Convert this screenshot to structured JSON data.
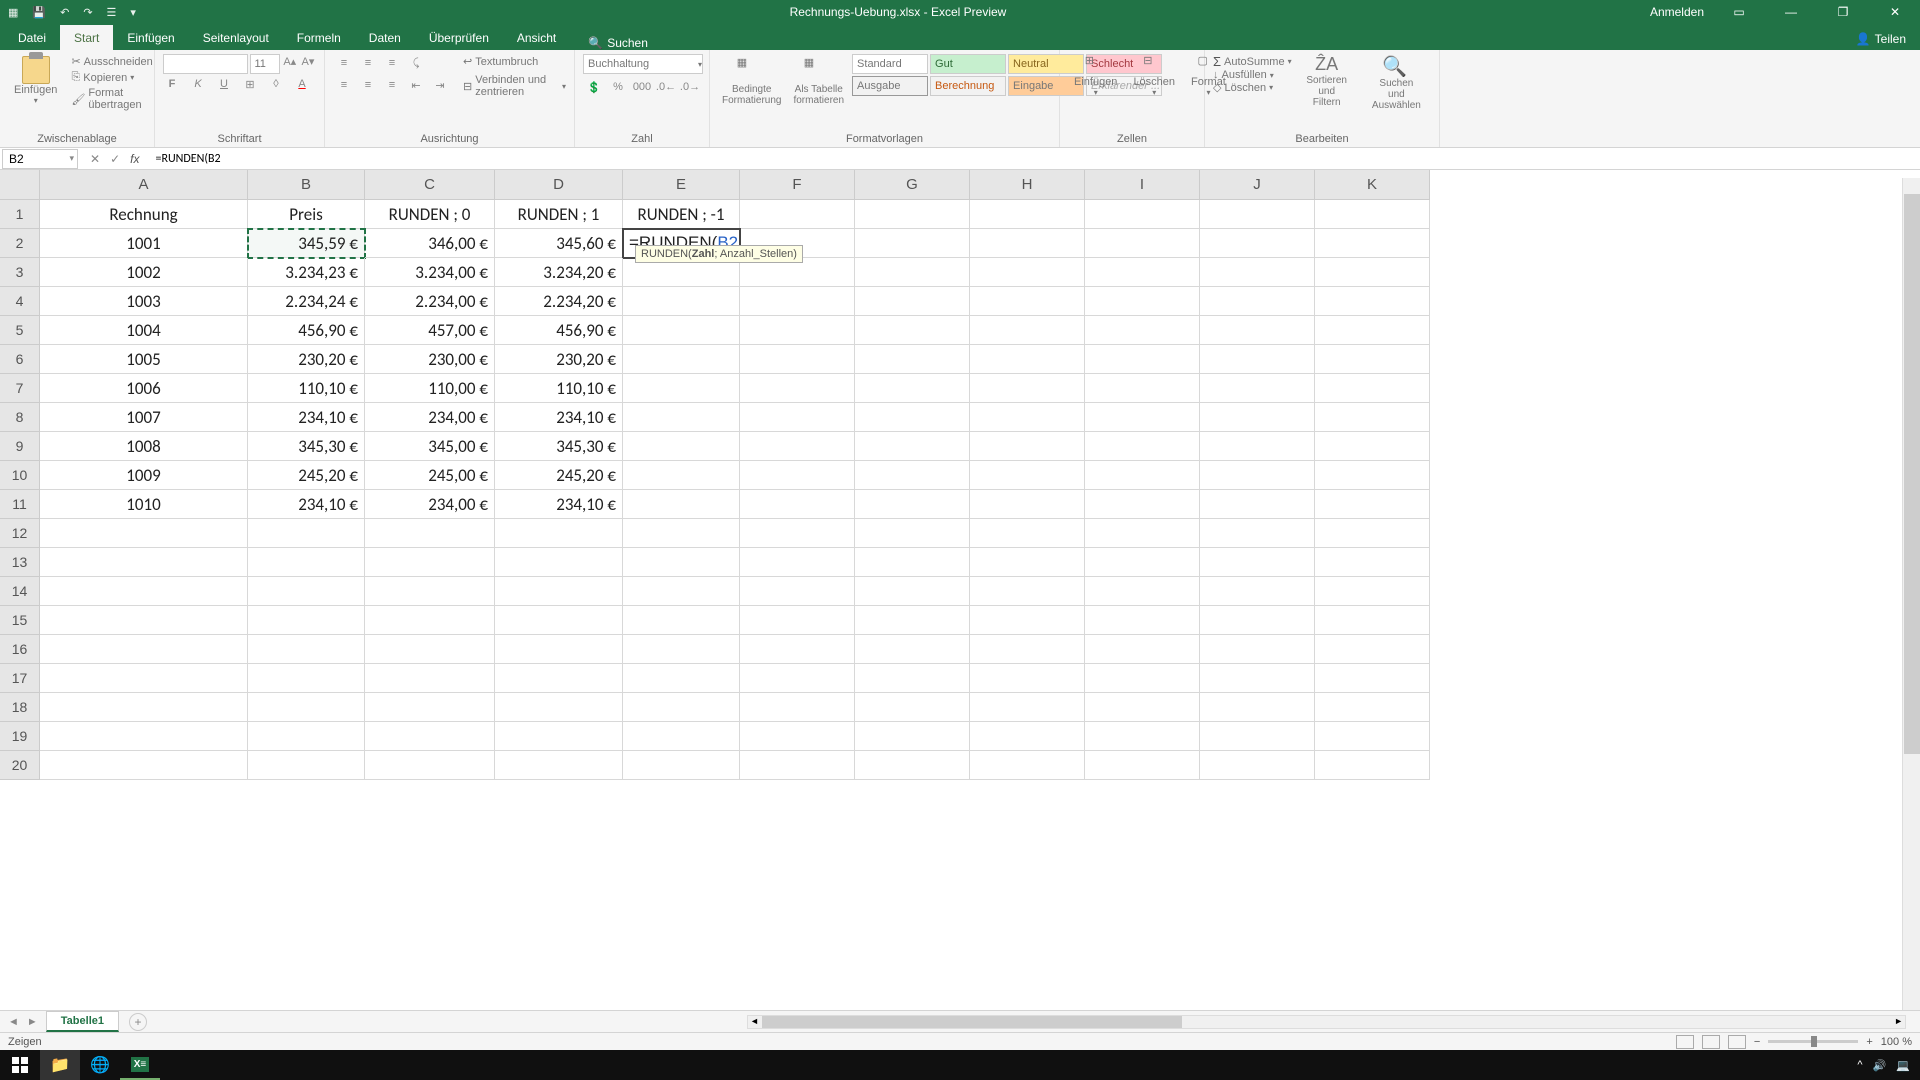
{
  "title": "Rechnungs-Uebung.xlsx - Excel Preview",
  "user_label": "Anmelden",
  "qat": {
    "save": "💾",
    "undo": "↶",
    "redo": "↷",
    "touch": "☰"
  },
  "ribbon_tabs": [
    "Datei",
    "Start",
    "Einfügen",
    "Seitenlayout",
    "Formeln",
    "Daten",
    "Überprüfen",
    "Ansicht"
  ],
  "ribbon_search_icon": "🔍",
  "ribbon_search": "Suchen",
  "ribbon_share": "Teilen",
  "ribbon": {
    "clipboard": {
      "paste": "Einfügen",
      "cut": "Ausschneiden",
      "copy": "Kopieren",
      "format": "Format übertragen",
      "label": "Zwischenablage"
    },
    "font": {
      "size": "11",
      "bold": "F",
      "italic": "K",
      "underline": "U",
      "label": "Schriftart"
    },
    "align": {
      "wrap": "Textumbruch",
      "merge": "Verbinden und zentrieren",
      "label": "Ausrichtung"
    },
    "number": {
      "format": "Buchhaltung",
      "label": "Zahl"
    },
    "styles": {
      "cond": "Bedingte Formatierung",
      "table": "Als Tabelle formatieren",
      "standard": "Standard",
      "gut": "Gut",
      "neutral": "Neutral",
      "schlecht": "Schlecht",
      "ausgabe": "Ausgabe",
      "berechnung": "Berechnung",
      "eingabe": "Eingabe",
      "erkl": "Erklärender ...",
      "label": "Formatvorlagen"
    },
    "cells": {
      "insert": "Einfügen",
      "delete": "Löschen",
      "format": "Format",
      "label": "Zellen"
    },
    "edit": {
      "sum": "AutoSumme",
      "fill": "Ausfüllen",
      "clear": "Löschen",
      "sort": "Sortieren und Filtern",
      "find": "Suchen und Auswählen",
      "label": "Bearbeiten"
    }
  },
  "name_box": "B2",
  "formula": "=RUNDEN(B2",
  "tooltip": {
    "fn": "RUNDEN(",
    "arg1": "Zahl",
    "sep": "; ",
    "arg2": "Anzahl_Stellen)"
  },
  "columns": [
    "A",
    "B",
    "C",
    "D",
    "E",
    "F",
    "G",
    "H",
    "I",
    "J",
    "K"
  ],
  "col_widths": {
    "A": 208,
    "B": 117,
    "C": 130,
    "D": 128,
    "E": 117,
    "F": 115,
    "G": 115,
    "H": 115,
    "I": 115,
    "J": 115,
    "K": 115
  },
  "row_numbers": [
    1,
    2,
    3,
    4,
    5,
    6,
    7,
    8,
    9,
    10,
    11,
    12,
    13,
    14,
    15,
    16,
    17,
    18,
    19,
    20
  ],
  "headers": {
    "A": "Rechnung",
    "B": "Preis",
    "C": "RUNDEN ; 0",
    "D": "RUNDEN ; 1",
    "E": "RUNDEN ; -1"
  },
  "data_rows": [
    {
      "A": "1001",
      "B": "345,59 €",
      "C": "346,00 €",
      "D": "345,60 €"
    },
    {
      "A": "1002",
      "B": "3.234,23 €",
      "C": "3.234,00 €",
      "D": "3.234,20 €"
    },
    {
      "A": "1003",
      "B": "2.234,24 €",
      "C": "2.234,00 €",
      "D": "2.234,20 €"
    },
    {
      "A": "1004",
      "B": "456,90 €",
      "C": "457,00 €",
      "D": "456,90 €"
    },
    {
      "A": "1005",
      "B": "230,20 €",
      "C": "230,00 €",
      "D": "230,20 €"
    },
    {
      "A": "1006",
      "B": "110,10 €",
      "C": "110,00 €",
      "D": "110,10 €"
    },
    {
      "A": "1007",
      "B": "234,10 €",
      "C": "234,00 €",
      "D": "234,10 €"
    },
    {
      "A": "1008",
      "B": "345,30 €",
      "C": "345,00 €",
      "D": "345,30 €"
    },
    {
      "A": "1009",
      "B": "245,20 €",
      "C": "245,00 €",
      "D": "245,20 €"
    },
    {
      "A": "1010",
      "B": "234,10 €",
      "C": "234,00 €",
      "D": "234,10 €"
    }
  ],
  "editing_cell_display": {
    "pre": "=RUNDEN(",
    "ref": "B2"
  },
  "sheet_tab": "Tabelle1",
  "status_mode": "Zeigen",
  "zoom": "100 %"
}
